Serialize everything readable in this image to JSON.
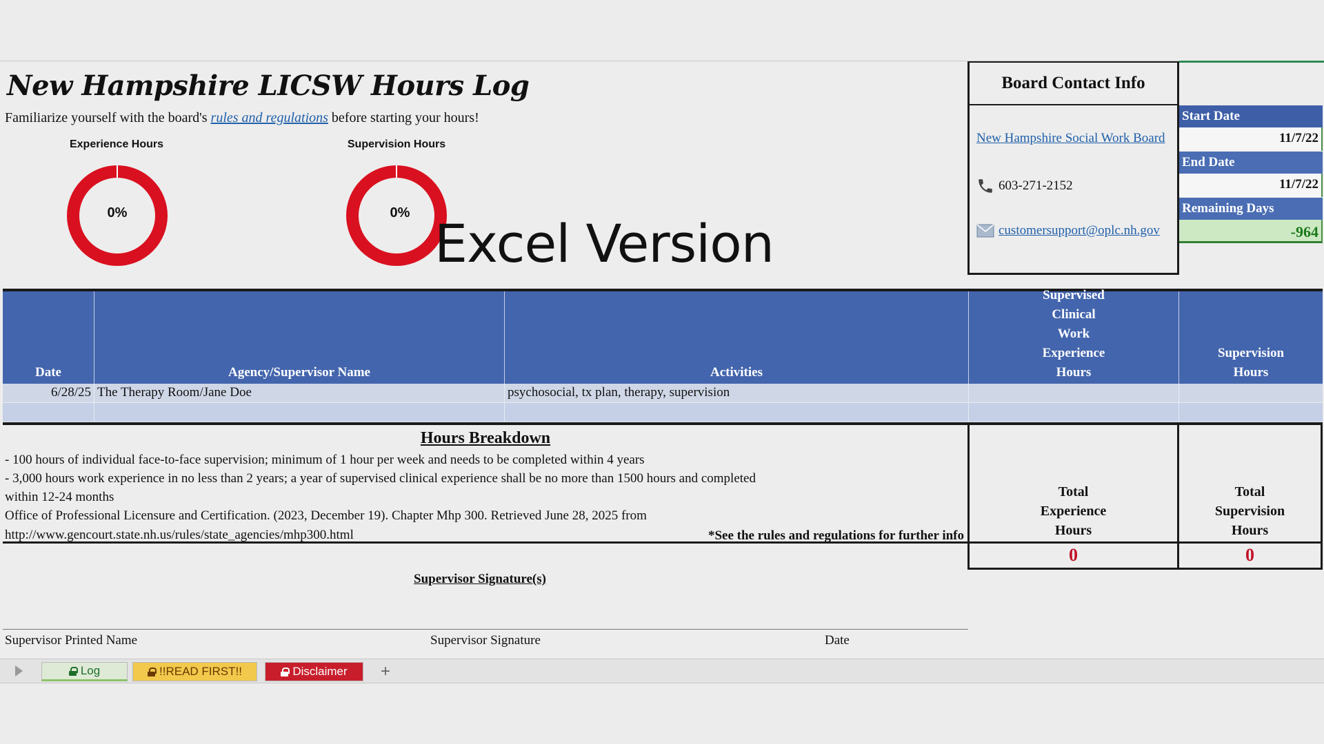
{
  "header": {
    "title": "New Hampshire LICSW Hours Log",
    "intro_before": "Familiarize yourself with the board's ",
    "intro_link": "rules and regulations",
    "intro_after": " before starting your hours!"
  },
  "gauges": [
    {
      "label": "Experience Hours",
      "percent_text": "0%",
      "progress": 0
    },
    {
      "label": "Supervision Hours",
      "percent_text": "0%",
      "progress": 0
    }
  ],
  "overlay_text": "Excel Version",
  "board": {
    "heading": "Board Contact Info",
    "link": "New Hampshire Social Work Board",
    "phone": "603-271-2152",
    "email": "customersupport@oplc.nh.gov"
  },
  "dates": {
    "start_label": "Start Date",
    "start_value": "11/7/22",
    "end_label": "End Date",
    "end_value": "11/7/22",
    "remaining_label": "Remaining Days",
    "remaining_value": "-964"
  },
  "table": {
    "headers": {
      "date": "Date",
      "agency": "Agency/Supervisor Name",
      "activities": "Activities",
      "experience": [
        "Supervised",
        "Clinical",
        "Work",
        "Experience",
        "Hours"
      ],
      "supervision": [
        "Supervision",
        "Hours"
      ]
    },
    "rows": [
      {
        "date": "6/28/25",
        "agency": "The Therapy Room/Jane Doe",
        "activities": "psychosocial, tx plan, therapy, supervision",
        "experience": "",
        "supervision": ""
      },
      {
        "date": "",
        "agency": "",
        "activities": "",
        "experience": "",
        "supervision": ""
      }
    ]
  },
  "breakdown": {
    "title": "Hours Breakdown",
    "lines": [
      "- 100 hours of individual face-to-face supervision; minimum of 1 hour per week and needs to be completed within 4 years",
      "- 3,000 hours work experience in no less than 2 years; a year of supervised clinical experience shall be no more than 1500 hours and completed",
      "within 12-24 months",
      "Office of Professional Licensure and Certification. (2023, December 19). Chapter Mhp 300. Retrieved June 28, 2025 from",
      "http://www.gencourt.state.nh.us/rules/state_agencies/mhp300.html"
    ],
    "note": "*See the rules and regulations for further info"
  },
  "totals": {
    "experience_label": [
      "Total",
      "Experience",
      "Hours"
    ],
    "experience_value": "0",
    "supervision_label": [
      "Total",
      "Supervision",
      "Hours"
    ],
    "supervision_value": "0"
  },
  "signatures": {
    "title": "Supervisor Signature(s)",
    "printed_name": "Supervisor Printed Name",
    "signature": "Supervisor Signature",
    "date": "Date"
  },
  "tabs": {
    "log": "Log",
    "read_first": "!!READ FIRST!!",
    "disclaimer": "Disclaimer",
    "add": "+"
  },
  "colors": {
    "header_blue": "#4365ad",
    "gauge_red": "#d9101f",
    "remaining_green": "#1c7a1c",
    "total_red": "#c0142a"
  }
}
